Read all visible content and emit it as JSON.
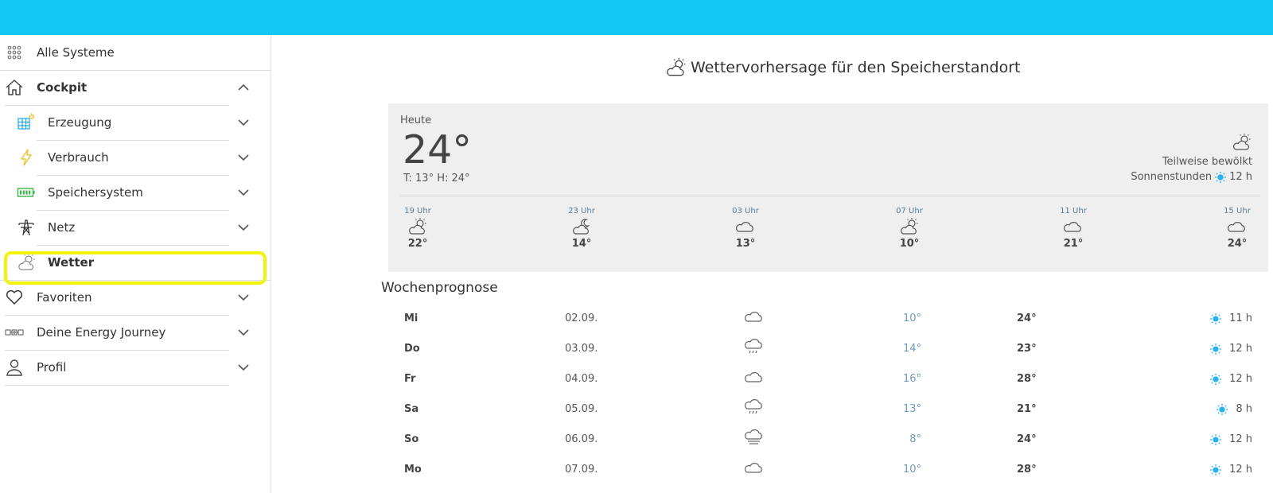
{
  "colors": {
    "topbar": "#12c9f6",
    "highlight": "#f2f20a",
    "sun": "#27b3ee",
    "min_temp": "#6f9bb7"
  },
  "sidebar": {
    "all_systems": {
      "label": "Alle Systeme",
      "icon": "grid-icon"
    },
    "items": [
      {
        "label": "Cockpit",
        "icon": "home-icon",
        "expanded": true
      },
      {
        "label": "Erzeugung",
        "icon": "solar-panel-icon"
      },
      {
        "label": "Verbrauch",
        "icon": "lightning-icon"
      },
      {
        "label": "Speichersystem",
        "icon": "battery-icon"
      },
      {
        "label": "Netz",
        "icon": "power-pylon-icon"
      },
      {
        "label": "Wetter",
        "icon": "weather-icon",
        "active": true
      },
      {
        "label": "Favoriten",
        "icon": "heart-icon"
      },
      {
        "label": "Deine Energy Journey",
        "icon": "journey-icon"
      },
      {
        "label": "Profil",
        "icon": "user-icon"
      }
    ]
  },
  "main": {
    "title": "Wettervorhersage für den Speicherstandort",
    "today": {
      "label": "Heute",
      "temp": "24°",
      "minmax": "T: 13° H: 24°",
      "condition": "Teilweise bewölkt",
      "sun_label": "Sonnenstunden",
      "sun_hours": "12 h",
      "hourly": [
        {
          "time": "19 Uhr",
          "temp": "22°",
          "icon": "partly-cloudy-day-icon"
        },
        {
          "time": "23 Uhr",
          "temp": "14°",
          "icon": "partly-cloudy-night-icon"
        },
        {
          "time": "03 Uhr",
          "temp": "13°",
          "icon": "cloud-icon"
        },
        {
          "time": "07 Uhr",
          "temp": "10°",
          "icon": "partly-cloudy-day-icon"
        },
        {
          "time": "11 Uhr",
          "temp": "21°",
          "icon": "cloud-icon"
        },
        {
          "time": "15 Uhr",
          "temp": "24°",
          "icon": "cloud-icon"
        }
      ]
    },
    "week": {
      "title": "Wochenprognose",
      "days": [
        {
          "day": "Mi",
          "date": "02.09.",
          "icon": "cloud-icon",
          "min": "10°",
          "max": "24°",
          "sun": "11 h"
        },
        {
          "day": "Do",
          "date": "03.09.",
          "icon": "rain-icon",
          "min": "14°",
          "max": "23°",
          "sun": "12 h"
        },
        {
          "day": "Fr",
          "date": "04.09.",
          "icon": "cloud-icon",
          "min": "16°",
          "max": "28°",
          "sun": "12 h"
        },
        {
          "day": "Sa",
          "date": "05.09.",
          "icon": "rain-icon",
          "min": "13°",
          "max": "21°",
          "sun": "8 h"
        },
        {
          "day": "So",
          "date": "06.09.",
          "icon": "fog-icon",
          "min": "8°",
          "max": "24°",
          "sun": "12 h"
        },
        {
          "day": "Mo",
          "date": "07.09.",
          "icon": "cloud-icon",
          "min": "10°",
          "max": "28°",
          "sun": "12 h"
        }
      ]
    }
  }
}
